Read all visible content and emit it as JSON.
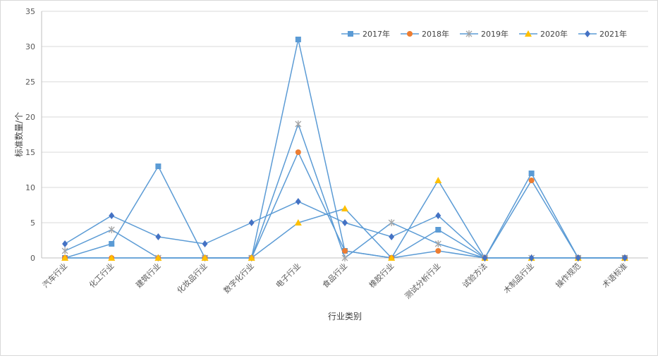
{
  "chart_data": {
    "type": "line",
    "title": "",
    "xlabel": "行业类别",
    "ylabel": "标准数量/个",
    "ylim": [
      0,
      35
    ],
    "yticks": [
      0,
      5,
      10,
      15,
      20,
      25,
      30,
      35
    ],
    "grid": true,
    "legend_position": "top-right",
    "categories": [
      "汽车行业",
      "化工行业",
      "建筑行业",
      "化妆品行业",
      "数字化行业",
      "电子行业",
      "食品行业",
      "橡胶行业",
      "测试分析行业",
      "试验方法",
      "木制品行业",
      "操作规范",
      "术语标准"
    ],
    "series": [
      {
        "name": "2017年",
        "marker": "square",
        "color": "#5b9bd5",
        "values": [
          0,
          2,
          13,
          0,
          0,
          31,
          1,
          0,
          4,
          0,
          12,
          0,
          0
        ]
      },
      {
        "name": "2018年",
        "marker": "circle",
        "color": "#ed7d31",
        "values": [
          0,
          0,
          0,
          0,
          0,
          15,
          1,
          0,
          1,
          0,
          11,
          0,
          0
        ]
      },
      {
        "name": "2019年",
        "marker": "star",
        "color": "#a5a5a5",
        "values": [
          1,
          4,
          0,
          0,
          0,
          19,
          0,
          5,
          2,
          0,
          0,
          0,
          0
        ]
      },
      {
        "name": "2020年",
        "marker": "triangle",
        "color": "#ffc000",
        "values": [
          0,
          0,
          0,
          0,
          0,
          5,
          7,
          0,
          11,
          0,
          0,
          0,
          0
        ]
      },
      {
        "name": "2021年",
        "marker": "diamond",
        "color": "#4472c4",
        "values": [
          2,
          6,
          3,
          2,
          5,
          8,
          5,
          3,
          6,
          0,
          0,
          0,
          0
        ]
      }
    ],
    "line_color": "#5b9bd5"
  }
}
